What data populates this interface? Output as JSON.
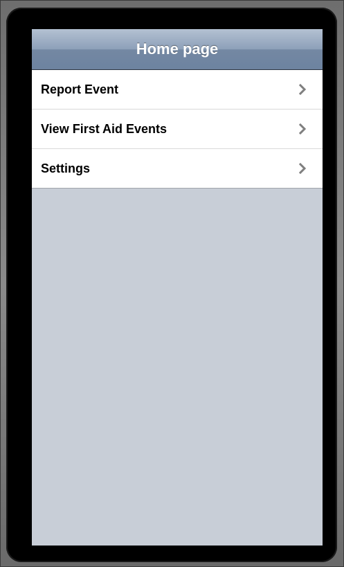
{
  "nav_bar": {
    "title": "Home page"
  },
  "table": {
    "rows": [
      {
        "label": "Report Event",
        "accessory": "chevron-right-icon"
      },
      {
        "label": "View First Aid Events",
        "accessory": "chevron-right-icon"
      },
      {
        "label": "Settings",
        "accessory": "chevron-right-icon"
      }
    ]
  },
  "colors": {
    "nav_bar_top": "#b4c1d2",
    "nav_bar_bottom": "#6d83a0",
    "screen_background": "#c8ced7",
    "row_background": "#ffffff",
    "chevron": "#7f7f7f",
    "bezel": "#000000"
  }
}
